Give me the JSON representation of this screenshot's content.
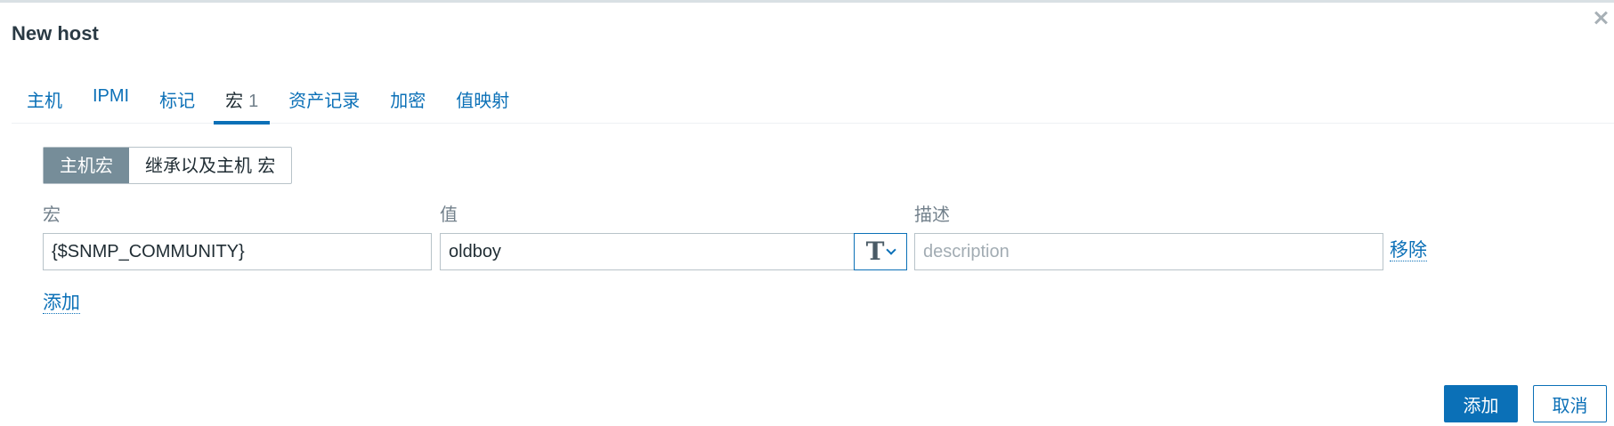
{
  "dialog": {
    "title": "New host"
  },
  "tabs": [
    {
      "label": "主机"
    },
    {
      "label": "IPMI"
    },
    {
      "label": "标记"
    },
    {
      "label": "宏",
      "count": "1"
    },
    {
      "label": "资产记录"
    },
    {
      "label": "加密"
    },
    {
      "label": "值映射"
    }
  ],
  "macro_mode": {
    "host_macros": "主机宏",
    "inherited_macros": "继承以及主机 宏"
  },
  "columns": {
    "macro": "宏",
    "value": "值",
    "description": "描述"
  },
  "macro_row": {
    "macro": "{$SNMP_COMMUNITY}",
    "value": "oldboy",
    "value_type_icon": "T",
    "description_placeholder": "description",
    "remove_label": "移除"
  },
  "add_row_label": "添加",
  "footer": {
    "add_label": "添加",
    "cancel_label": "取消"
  },
  "colors": {
    "accent": "#0b70b7",
    "segment_active": "#768d99"
  }
}
